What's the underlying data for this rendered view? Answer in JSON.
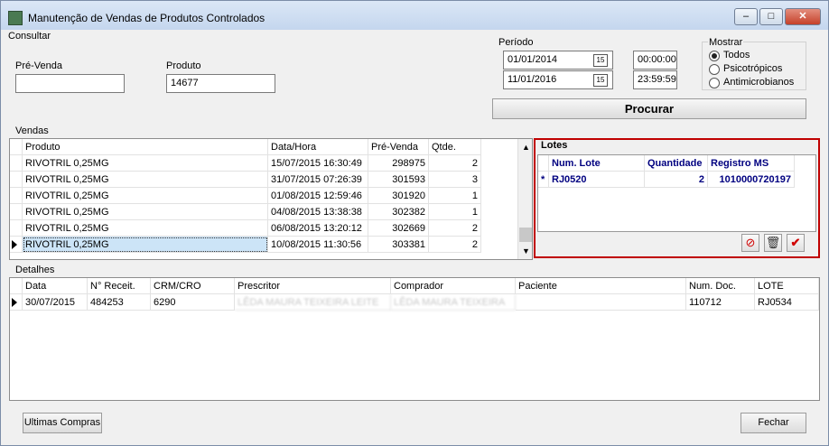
{
  "window": {
    "title": "Manutenção de Vendas de Produtos Controlados",
    "minimize_icon": "minimize-icon",
    "maximize_icon": "maximize-icon",
    "close_icon": "close-icon"
  },
  "consultar": {
    "group_label": "Consultar",
    "pre_venda_label": "Pré-Venda",
    "pre_venda_value": "",
    "produto_label": "Produto",
    "produto_value": "14677"
  },
  "periodo": {
    "label": "Período",
    "start_date": "01/01/2014",
    "start_time": "00:00:00",
    "end_date": "11/01/2016",
    "end_time": "23:59:59",
    "calendar_icon_text": "15"
  },
  "mostrar": {
    "label": "Mostrar",
    "options": [
      "Todos",
      "Psicotrópicos",
      "Antimicrobianos"
    ],
    "selected": "Todos"
  },
  "procurar_label": "Procurar",
  "vendas": {
    "group_label": "Vendas",
    "headers": [
      "Produto",
      "Data/Hora",
      "Pré-Venda",
      "Qtde."
    ],
    "rows": [
      [
        "RIVOTRIL 0,25MG",
        "15/07/2015 16:30:49",
        "298975",
        "2"
      ],
      [
        "RIVOTRIL 0,25MG",
        "31/07/2015 07:26:39",
        "301593",
        "3"
      ],
      [
        "RIVOTRIL 0,25MG",
        "01/08/2015 12:59:46",
        "301920",
        "1"
      ],
      [
        "RIVOTRIL 0,25MG",
        "04/08/2015 13:38:38",
        "302382",
        "1"
      ],
      [
        "RIVOTRIL 0,25MG",
        "06/08/2015 13:20:12",
        "302669",
        "2"
      ],
      [
        "RIVOTRIL 0,25MG",
        "10/08/2015 11:30:56",
        "303381",
        "2"
      ]
    ]
  },
  "lotes": {
    "label": "Lotes",
    "headers": [
      "Num. Lote",
      "Quantidade",
      "Registro MS"
    ],
    "row_marker": "*",
    "rows": [
      [
        "RJ0520",
        "2",
        "1010000720197"
      ]
    ],
    "toolbar": {
      "cancel_icon": "cancel-icon",
      "delete_icon": "trash-icon",
      "confirm_icon": "check-icon"
    }
  },
  "detalhes": {
    "group_label": "Detalhes",
    "headers": [
      "Data",
      "N° Receit.",
      "CRM/CRO",
      "Prescritor",
      "Comprador",
      "Paciente",
      "Num. Doc.",
      "LOTE"
    ],
    "rows": [
      [
        "30/07/2015",
        "484253",
        "6290",
        "LÊDA MAURA TEIXEIRA LEITE",
        "LÊDA MAURA TEIXEIRA",
        "",
        "110712",
        "RJ0534"
      ]
    ]
  },
  "footer": {
    "ultimas_compras_label": "Ultimas Compras",
    "fechar_label": "Fechar"
  },
  "colors": {
    "lotes_border": "#c00000",
    "lotes_text": "#000080",
    "selected_row": "#cce4f7"
  }
}
